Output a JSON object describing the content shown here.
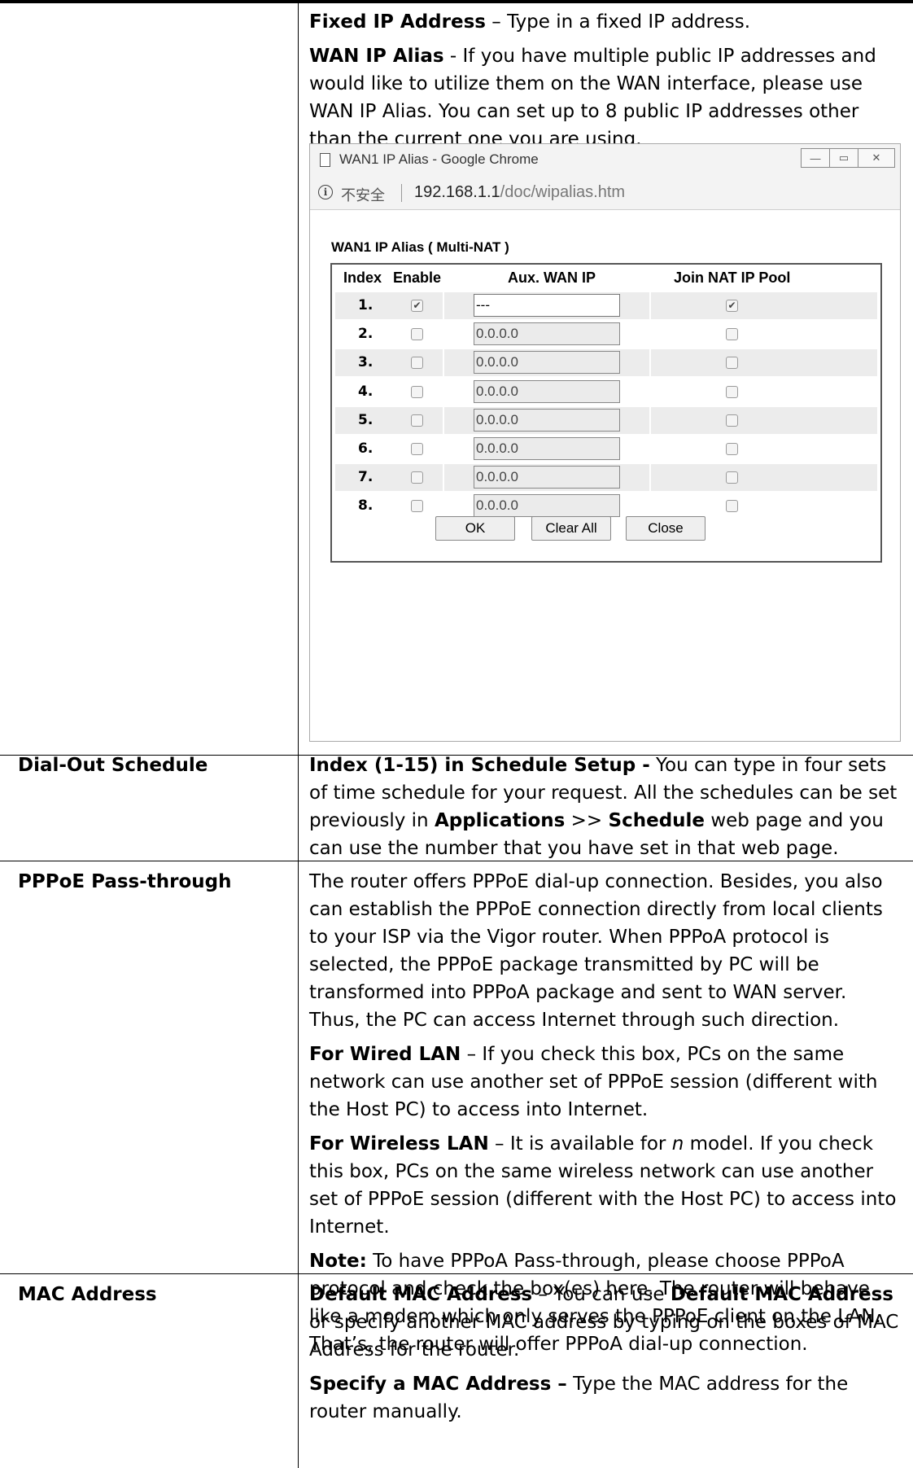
{
  "alias_para": {
    "fixed_ip": {
      "term": "Fixed IP Address",
      "text": " – Type in a fixed IP address."
    },
    "wan_ip_alias": {
      "term": "WAN IP Alias",
      "text": " - If you have multiple public IP addresses and would like to utilize them on the WAN interface, please use WAN IP Alias. You can set up to 8 public IP addresses other than the current one you are using."
    }
  },
  "window": {
    "title": "WAN1 IP Alias - Google Chrome",
    "insecure_label": "不安全",
    "url_host": "192.168.1.1",
    "url_path": "/doc/wipalias.htm",
    "heading": "WAN1 IP Alias ( Multi-NAT )",
    "columns": [
      "Index",
      "Enable",
      "Aux. WAN IP",
      "Join NAT IP Pool"
    ],
    "rows": [
      {
        "index": "1.",
        "enable": true,
        "ip": "---",
        "join_nat": true
      },
      {
        "index": "2.",
        "enable": false,
        "ip": "0.0.0.0",
        "join_nat": false
      },
      {
        "index": "3.",
        "enable": false,
        "ip": "0.0.0.0",
        "join_nat": false
      },
      {
        "index": "4.",
        "enable": false,
        "ip": "0.0.0.0",
        "join_nat": false
      },
      {
        "index": "5.",
        "enable": false,
        "ip": "0.0.0.0",
        "join_nat": false
      },
      {
        "index": "6.",
        "enable": false,
        "ip": "0.0.0.0",
        "join_nat": false
      },
      {
        "index": "7.",
        "enable": false,
        "ip": "0.0.0.0",
        "join_nat": false
      },
      {
        "index": "8.",
        "enable": false,
        "ip": "0.0.0.0",
        "join_nat": false
      }
    ],
    "buttons": {
      "ok": "OK",
      "clear_all": "Clear All",
      "close": "Close"
    }
  },
  "sections": {
    "dial_out": {
      "label": "Dial-Out Schedule",
      "term": "Index (1-15) in Schedule Setup -",
      "text1": " You can type in four sets of time schedule for your request. All the schedules can be set previously in ",
      "applications": "Applications",
      "sep": " >> ",
      "schedule": "Schedule",
      "text2": " web page and you can use the number that you have set in that web page."
    },
    "pppoe": {
      "label": "PPPoE Pass-through",
      "intro": "The router offers PPPoE dial-up connection. Besides, you also can establish the PPPoE connection directly from local clients to your ISP via the Vigor router. When PPPoA protocol is selected, the PPPoE package transmitted by PC will be transformed into PPPoA package and sent to WAN server. Thus, the PC can access Internet through such direction.",
      "wired_term": "For Wired LAN",
      "wired_text": " – If you check this box, PCs on the same network can use another set of PPPoE session (different with the Host PC) to access into Internet.",
      "wireless_term": "For Wireless LAN",
      "wireless_text1": " – It is available for ",
      "wireless_n": "n",
      "wireless_text2": " model. If you check this box, PCs on the same wireless network can use another set of PPPoE session (different with the Host PC) to access into Internet.",
      "note_term": "Note:",
      "note_text": " To have PPPoA Pass-through, please choose PPPoA protocol and check the box(es) here. The router will behave like a modem which only serves the PPPoE client on the LAN. That’s, the router will offer PPPoA dial-up connection."
    },
    "mac": {
      "label": "MAC Address",
      "default_term": "Default MAC Address",
      "default_text1": " – You can use ",
      "default_term2": "Default MAC Address",
      "default_text2": " or specify another MAC address by typing on the boxes of MAC Address for the router.",
      "specify_term": "Specify a MAC Address –",
      "specify_text": " Type the MAC address for the router manually."
    }
  }
}
